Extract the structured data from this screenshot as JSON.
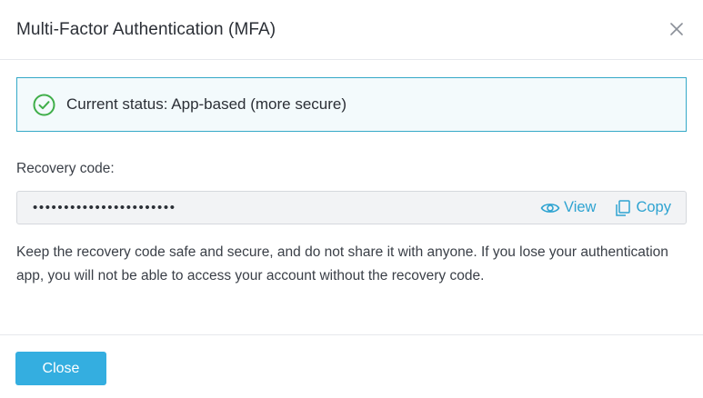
{
  "dialog": {
    "title": "Multi-Factor Authentication (MFA)",
    "close_icon": "close-icon"
  },
  "status": {
    "icon": "check-circle-icon",
    "text": "Current status: App-based (more secure)",
    "accent_color": "#35a9c8",
    "icon_color": "#3fae49"
  },
  "recovery": {
    "label": "Recovery code:",
    "masked_value": "•••••••••••••••••••••••",
    "view_label": "View",
    "view_icon": "eye-icon",
    "copy_label": "Copy",
    "copy_icon": "copy-icon",
    "help_text": "Keep the recovery code safe and secure, and do not share it with anyone. If you lose your authentication app, you will not be able to access your account without the recovery code."
  },
  "footer": {
    "close_label": "Close",
    "button_color": "#34aee0"
  }
}
